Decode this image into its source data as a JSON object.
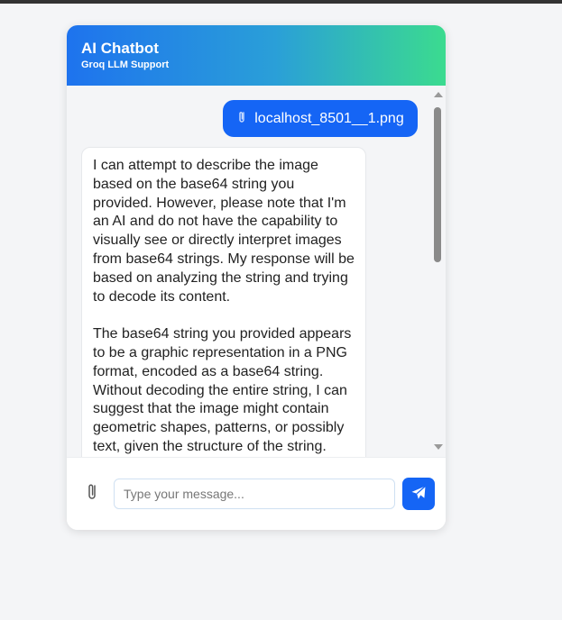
{
  "header": {
    "title": "AI Chatbot",
    "subtitle": "Groq LLM Support"
  },
  "messages": {
    "user_attachment": {
      "icon": "paperclip-icon",
      "filename": "localhost_8501__1.png"
    },
    "bot_reply": {
      "paragraph_1": "I can attempt to describe the image based on the base64 string you provided. However, please note that I'm an AI and do not have the capability to visually see or directly interpret images from base64 strings. My response will be based on analyzing the string and trying to decode its content.",
      "paragraph_2": "The base64 string you provided appears to be a graphic representation in a PNG format, encoded as a base64 string. Without decoding the entire string, I can suggest that the image might contain geometric shapes, patterns, or possibly text, given the structure of the string."
    }
  },
  "composer": {
    "placeholder": "Type your message...",
    "value": "",
    "attach_icon": "paperclip-icon",
    "send_icon": "paper-plane-icon"
  },
  "colors": {
    "accent": "#1565f5",
    "header_gradient_start": "#1e73ee",
    "header_gradient_end": "#3bdb8f"
  }
}
